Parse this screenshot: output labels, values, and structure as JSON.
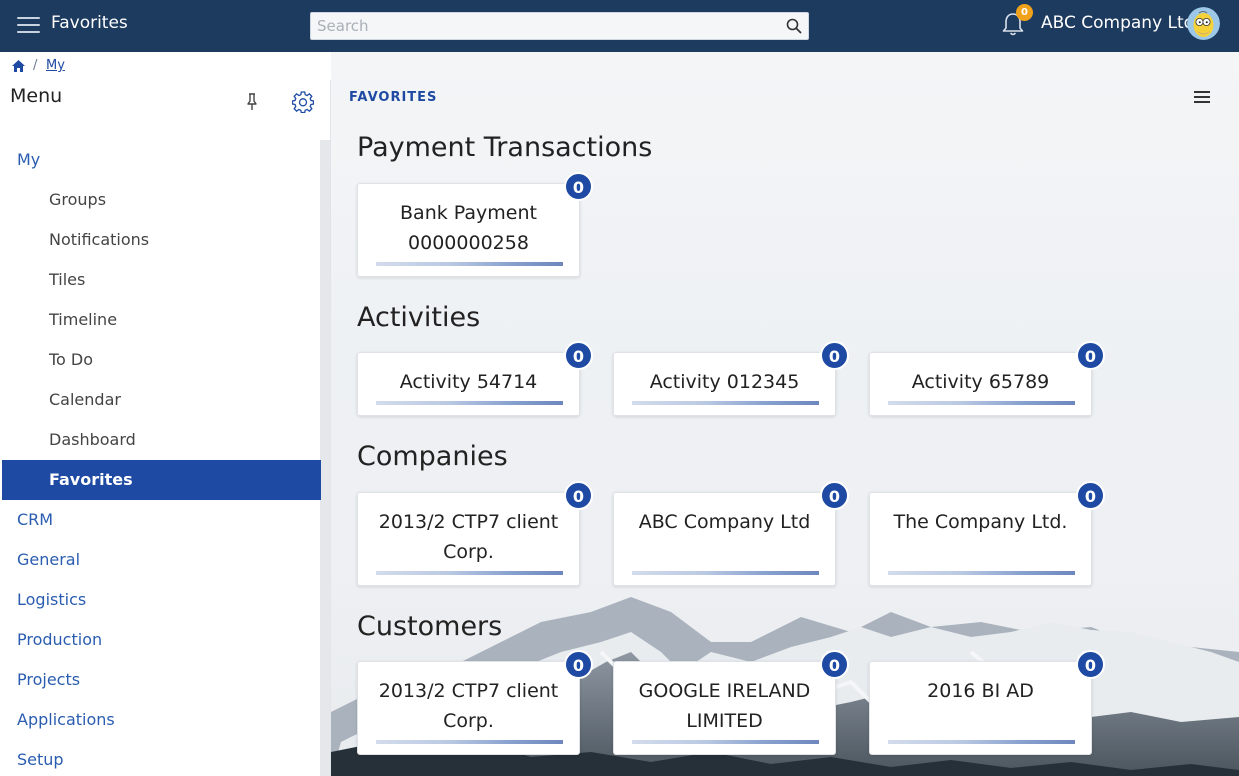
{
  "topbar": {
    "title": "Favorites",
    "search_placeholder": "Search",
    "notification_count": "0",
    "company_name": "ABC Company Ltd."
  },
  "breadcrumb": {
    "separator": "/",
    "current": "My"
  },
  "sidebar": {
    "title": "Menu",
    "items": [
      {
        "label": "My",
        "level": "top"
      },
      {
        "label": "Groups",
        "level": "sub"
      },
      {
        "label": "Notifications",
        "level": "sub"
      },
      {
        "label": "Tiles",
        "level": "sub"
      },
      {
        "label": "Timeline",
        "level": "sub"
      },
      {
        "label": "To Do",
        "level": "sub"
      },
      {
        "label": "Calendar",
        "level": "sub"
      },
      {
        "label": "Dashboard",
        "level": "sub"
      },
      {
        "label": "Favorites",
        "level": "sub",
        "active": true
      },
      {
        "label": "CRM",
        "level": "top"
      },
      {
        "label": "General",
        "level": "top"
      },
      {
        "label": "Logistics",
        "level": "top"
      },
      {
        "label": "Production",
        "level": "top"
      },
      {
        "label": "Projects",
        "level": "top"
      },
      {
        "label": "Applications",
        "level": "top"
      },
      {
        "label": "Setup",
        "level": "top"
      }
    ]
  },
  "content": {
    "section_tag": "FAVORITES",
    "groups": [
      {
        "title": "Payment Transactions",
        "tiles": [
          {
            "label": "Bank Payment 0000000258",
            "count": "0"
          }
        ]
      },
      {
        "title": "Activities",
        "tiles": [
          {
            "label": "Activity 54714",
            "count": "0"
          },
          {
            "label": "Activity 012345",
            "count": "0"
          },
          {
            "label": "Activity 65789",
            "count": "0"
          }
        ]
      },
      {
        "title": "Companies",
        "tiles": [
          {
            "label": "2013/2 CTP7 client Corp.",
            "count": "0"
          },
          {
            "label": "ABC Company Ltd",
            "count": "0"
          },
          {
            "label": "The Company Ltd.",
            "count": "0"
          }
        ]
      },
      {
        "title": "Customers",
        "tiles": [
          {
            "label": "2013/2 CTP7 client Corp.",
            "count": "0"
          },
          {
            "label": "GOOGLE IRELAND LIMITED",
            "count": "0"
          },
          {
            "label": "2016 BI AD",
            "count": "0"
          }
        ]
      }
    ]
  },
  "colors": {
    "topbar_bg": "#1d3a5f",
    "accent": "#1e4aa3",
    "notification_badge": "#f0a21a"
  },
  "icons": {
    "menu": "hamburger-menu-icon",
    "search": "search-icon",
    "notifications": "bell-icon",
    "home": "home-icon",
    "pin": "pin-icon",
    "settings": "gear-icon",
    "content_menu": "list-menu-icon"
  }
}
